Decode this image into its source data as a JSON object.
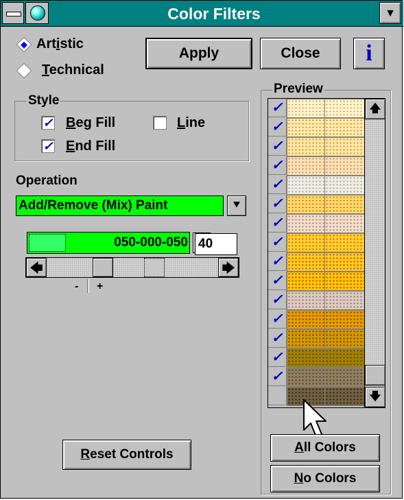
{
  "window": {
    "title": "Color Filters"
  },
  "icons": {
    "system": "system-menu-icon",
    "app": "gem-app-icon",
    "dropdown": "chevron-down-icon",
    "info": "info-icon"
  },
  "mode": {
    "artistic_pre": "Art",
    "artistic_u": "i",
    "artistic_post": "stic",
    "technical_pre": "",
    "technical_u": "T",
    "technical_post": "echnical",
    "selected": "Artistic"
  },
  "buttons": {
    "apply": "Apply",
    "close": "Close",
    "info": "i"
  },
  "style": {
    "label": "Style",
    "beg_fill_u": "B",
    "beg_fill_post": "eg Fill",
    "beg_fill_checked": true,
    "end_fill_u": "E",
    "end_fill_post": "nd Fill",
    "end_fill_checked": true,
    "line_u": "L",
    "line_post": "ine",
    "line_checked": false
  },
  "operation": {
    "label": "Operation",
    "value": "Add/Remove (Mix) Paint"
  },
  "color": {
    "value": "050-000-050",
    "amount": "40"
  },
  "slider": {
    "minus": "-",
    "plus": "+"
  },
  "reset": {
    "u": "R",
    "post": "eset Controls"
  },
  "preview": {
    "label": "Preview",
    "swatches": [
      {
        "checked": true,
        "c1": "#fff5cc",
        "c2": "#fff6d0",
        "dot": "#e0a060"
      },
      {
        "checked": true,
        "c1": "#ffeeaa",
        "c2": "#ffeeaa",
        "dot": "#e08040"
      },
      {
        "checked": true,
        "c1": "#ffe8a0",
        "c2": "#ffe8a0",
        "dot": "#d09050"
      },
      {
        "checked": true,
        "c1": "#ffe4a8",
        "c2": "#ffe4a8",
        "dot": "#c080a0"
      },
      {
        "checked": true,
        "c1": "#f0eedd",
        "c2": "#f0eedd",
        "dot": "#a0a0c0"
      },
      {
        "checked": true,
        "c1": "#ffdd66",
        "c2": "#ffdd66",
        "dot": "#e06030"
      },
      {
        "checked": true,
        "c1": "#eee0cc",
        "c2": "#eee0cc",
        "dot": "#c07070"
      },
      {
        "checked": true,
        "c1": "#ffd030",
        "c2": "#ffd030",
        "dot": "#e06000"
      },
      {
        "checked": true,
        "c1": "#ffcc20",
        "c2": "#ffcc20",
        "dot": "#d04000"
      },
      {
        "checked": true,
        "c1": "#ffc800",
        "c2": "#ffc800",
        "dot": "#c03000"
      },
      {
        "checked": true,
        "c1": "#d8cfc0",
        "c2": "#d8cfc0",
        "dot": "#b06070"
      },
      {
        "checked": true,
        "c1": "#e0a000",
        "c2": "#e0a000",
        "dot": "#a03000"
      },
      {
        "checked": true,
        "c1": "#d09a00",
        "c2": "#d09a00",
        "dot": "#803000"
      },
      {
        "checked": true,
        "c1": "#a08000",
        "c2": "#a08000",
        "dot": "#604000"
      },
      {
        "checked": true,
        "c1": "#908060",
        "c2": "#908060",
        "dot": "#504030"
      },
      {
        "checked": false,
        "c1": "#706040",
        "c2": "#706040",
        "dot": "#302010"
      }
    ]
  },
  "preview_buttons": {
    "all_u": "A",
    "all_post": "ll Colors",
    "no_u": "N",
    "no_post": "o Colors"
  }
}
